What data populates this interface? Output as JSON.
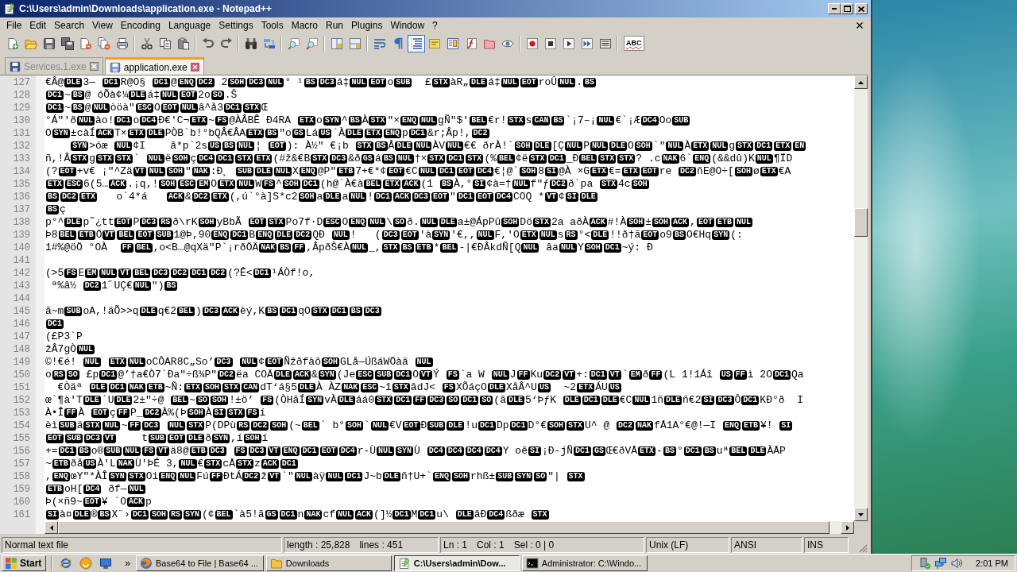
{
  "window": {
    "title": "C:\\Users\\admin\\Downloads\\application.exe - Notepad++"
  },
  "menu": [
    "File",
    "Edit",
    "Search",
    "View",
    "Encoding",
    "Language",
    "Settings",
    "Tools",
    "Macro",
    "Run",
    "Plugins",
    "Window",
    "?"
  ],
  "toolbar": {
    "toggles": [
      {
        "on": false
      },
      {
        "on": false
      },
      {
        "on": true
      }
    ],
    "spell_check": "ABC"
  },
  "tabs": [
    {
      "label": "Services.1.exe",
      "selected": false
    },
    {
      "label": "application.exe",
      "selected": true
    }
  ],
  "editor": {
    "lines": [
      {
        "number": "127",
        "runs": [
          {
            "text": "€Â@",
            "codes": [
              "DLE"
            ]
          },
          {
            "text": "3— ",
            "codes": [
              "DC1"
            ]
          },
          {
            "text": "R@O§ ",
            "codes": [
              "DC1"
            ]
          },
          {
            "text": "@",
            "codes": [
              "ENQ",
              "DC2"
            ]
          },
          {
            "text": " 2",
            "codes": [
              "SOH",
              "DC3",
              "NUL"
            ]
          },
          {
            "text": "° ¹",
            "codes": [
              "BS",
              "DC3"
            ]
          },
          {
            "text": "á‡",
            "codes": [
              "NUL",
              "EOT"
            ]
          },
          {
            "text": "o",
            "codes": [
              "SUB"
            ]
          },
          {
            "text": "  £",
            "codes": [
              "STX"
            ]
          },
          {
            "text": "àR„",
            "codes": [
              "DLE"
            ]
          },
          {
            "text": "á‡",
            "codes": [
              "NUL",
              "EOT"
            ]
          },
          {
            "text": "roÛ",
            "codes": [
              "NUL"
            ]
          },
          {
            "text": ".",
            "codes": [
              "BS"
            ]
          }
        ]
      },
      {
        "number": "128",
        "runs": [
          {
            "codes": [
              "DC1"
            ]
          },
          {
            "text": "~",
            "codes": [
              "BS"
            ]
          },
          {
            "text": "@ óÕà¢¼",
            "codes": [
              "DLE"
            ]
          },
          {
            "text": "á‡",
            "codes": [
              "NUL",
              "EOT"
            ]
          },
          {
            "text": "2o",
            "codes": [
              "SO"
            ]
          },
          {
            "text": ".Š"
          }
        ]
      },
      {
        "number": "129",
        "runs": [
          {
            "codes": [
              "DC1"
            ]
          },
          {
            "text": "~",
            "codes": [
              "BS"
            ]
          },
          {
            "text": "@",
            "codes": [
              "NUL"
            ]
          },
          {
            "text": "òöà\"",
            "codes": [
              "ESC"
            ]
          },
          {
            "text": "O",
            "codes": [
              "EOT",
              "NUL"
            ]
          },
          {
            "text": "â^å3",
            "codes": [
              "DC1",
              "STX"
            ]
          },
          {
            "text": "Œ"
          }
        ]
      },
      {
        "number": "130",
        "runs": [
          {
            "text": "°Á\"'ð",
            "codes": [
              "NUL"
            ]
          },
          {
            "text": "ào!",
            "codes": [
              "DC1"
            ]
          },
          {
            "text": "o",
            "codes": [
              "DC4"
            ]
          },
          {
            "text": "Ð€'C¬",
            "codes": [
              "ETX"
            ]
          },
          {
            "text": "~",
            "codes": [
              "FS"
            ]
          },
          {
            "text": "@ÀÂBÊ Ð4RA ",
            "codes": [
              "ETX"
            ]
          },
          {
            "text": "o",
            "codes": [
              "SYN"
            ]
          },
          {
            "text": "^",
            "codes": [
              "BS"
            ]
          },
          {
            "text": "À",
            "codes": [
              "STX"
            ]
          },
          {
            "text": "\"×",
            "codes": [
              "ENQ",
              "NUL"
            ]
          },
          {
            "text": "gÑ\"$'",
            "codes": [
              "BEL"
            ]
          },
          {
            "text": "€r!",
            "codes": [
              "STX"
            ]
          },
          {
            "text": "s",
            "codes": [
              "CAN",
              "BS"
            ]
          },
          {
            "text": "`¡7–¡",
            "codes": [
              "NUL"
            ]
          },
          {
            "text": "€`¡Æ",
            "codes": [
              "DC4"
            ]
          },
          {
            "text": "Oo",
            "codes": [
              "SUB"
            ]
          }
        ]
      },
      {
        "number": "131",
        "runs": [
          {
            "text": "O",
            "codes": [
              "SYN"
            ]
          },
          {
            "text": "±càÍ",
            "codes": [
              "ACK"
            ]
          },
          {
            "text": "T×",
            "codes": [
              "ETX",
              "DLE"
            ]
          },
          {
            "text": "PÒB`b!°bQÂ"
          },
          {
            "text": "€ÂA",
            "codes": [
              "ETX",
              "BS"
            ]
          },
          {
            "text": "\"o",
            "codes": [
              "GS"
            ]
          },
          {
            "text": "Lá",
            "codes": [
              "US"
            ]
          },
          {
            "text": "`À",
            "codes": [
              "DLE",
              "ETX",
              "ENQ"
            ]
          },
          {
            "text": "p",
            "codes": [
              "DC1"
            ]
          },
          {
            "text": "&r;Âp!,",
            "codes": [
              "DC2"
            ]
          }
        ]
      },
      {
        "number": "132",
        "runs": [
          {
            "indent": true,
            "codes": [
              "SYN"
            ]
          },
          {
            "text": ">óæ ",
            "codes": [
              "NUL"
            ]
          },
          {
            "text": "¢I    â*p`2s",
            "codes": [
              "US",
              "BS",
              "NUL"
            ]
          },
          {
            "text": "¦ ",
            "codes": [
              "EOT"
            ]
          },
          {
            "text": "): À½\" €¡b ",
            "codes": [
              "STX",
              "BS"
            ]
          },
          {
            "text": "Â",
            "codes": [
              "DLE",
              "NUL"
            ]
          },
          {
            "text": "ÀV",
            "codes": [
              "NUL"
            ]
          },
          {
            "text": "€€ ðrÀ!`",
            "codes": [
              "SOH",
              "DLE"
            ]
          },
          {
            "text": "[Ç",
            "codes": [
              "NUL"
            ]
          },
          {
            "text": "P",
            "codes": [
              "NUL",
              "DLE"
            ]
          },
          {
            "text": "O",
            "codes": [
              "SOH"
            ]
          },
          {
            "text": "`\"",
            "codes": [
              "NUL"
            ]
          },
          {
            "text": "À",
            "codes": [
              "ETX",
              "NUL"
            ]
          },
          {
            "text": "g",
            "codes": [
              "STX",
              "DC1",
              "ETX",
              "EN"
            ]
          }
        ]
      },
      {
        "number": "133",
        "runs": [
          {
            "text": "ñ,!Â",
            "codes": [
              "STX"
            ]
          },
          {
            "text": "g",
            "codes": [
              "STX",
              "STX"
            ]
          },
          {
            "text": "` ",
            "codes": [
              "NUL"
            ]
          },
          {
            "text": "ë",
            "codes": [
              "SOH"
            ]
          },
          {
            "text": "ç",
            "codes": [
              "DC4",
              "DC1",
              "STX",
              "ETX"
            ]
          },
          {
            "text": "(#ž&€B",
            "codes": [
              "STX",
              "DC3"
            ]
          },
          {
            "text": "&ð",
            "codes": [
              "GS"
            ]
          },
          {
            "text": "á",
            "codes": [
              "BS",
              "NUL"
            ]
          },
          {
            "text": "†×",
            "codes": [
              "STX",
              "DC1",
              "STX"
            ]
          },
          {
            "text": "(%",
            "codes": [
              "BEL"
            ]
          },
          {
            "text": "¢ë",
            "codes": [
              "STX",
              "DC1"
            ]
          },
          {
            "text": "_Ð",
            "codes": [
              "BEL",
              "STX",
              "STX"
            ]
          },
          {
            "text": "? .c",
            "codes": [
              "NAK"
            ]
          },
          {
            "text": "6`",
            "codes": [
              "ENQ"
            ]
          },
          {
            "text": "(&&dû)K",
            "codes": [
              "NUL"
            ]
          },
          {
            "text": "¶ÏD"
          }
        ]
      },
      {
        "number": "134",
        "runs": [
          {
            "text": "(?",
            "codes": [
              "EOT"
            ]
          },
          {
            "text": "+v€ ¡\"^Zä",
            "codes": [
              "VT",
              "NUL",
              "SOH"
            ]
          },
          {
            "text": "\"",
            "codes": [
              "NAK"
            ]
          },
          {
            "text": ":Ð¸ ",
            "codes": [
              "SUB",
              "DLE",
              "NUL"
            ]
          },
          {
            "text": "X",
            "codes": [
              "ENQ"
            ]
          },
          {
            "text": "@P\"",
            "codes": [
              "ETB"
            ]
          },
          {
            "text": "7+€*¢",
            "codes": [
              "EOT"
            ]
          },
          {
            "text": "€C",
            "codes": [
              "NUL",
              "DC1",
              "EOT",
              "DC4"
            ]
          },
          {
            "text": "€¦@`",
            "codes": [
              "SOH"
            ]
          },
          {
            "text": "8",
            "codes": [
              "SI"
            ]
          },
          {
            "text": "@À ×G",
            "codes": [
              "ETX"
            ]
          },
          {
            "text": "€=",
            "codes": [
              "ETX",
              "EOT"
            ]
          },
          {
            "text": "re ",
            "codes": [
              "DC2"
            ]
          },
          {
            "text": "ñE@O÷[",
            "codes": [
              "SOH"
            ]
          },
          {
            "text": "ø",
            "codes": [
              "ETX"
            ]
          },
          {
            "text": "€A"
          }
        ]
      },
      {
        "number": "135",
        "runs": [
          {
            "codes": [
              "ETX",
              "ESC"
            ]
          },
          {
            "text": "6(5…",
            "codes": [
              "ACK"
            ]
          },
          {
            "text": ".¡q,!",
            "codes": [
              "SOH",
              "ESC",
              "EM"
            ]
          },
          {
            "text": "O",
            "codes": [
              "ETX",
              "NUL"
            ]
          },
          {
            "text": "W",
            "codes": [
              "FS"
            ]
          },
          {
            "text": "^",
            "codes": [
              "SOH",
              "DC1"
            ]
          },
          {
            "text": "(h@`À€à",
            "codes": [
              "BEL",
              "ETX",
              "ACK"
            ]
          },
          {
            "text": "(1 ",
            "codes": [
              "BS"
            ]
          },
          {
            "text": "À,°",
            "codes": [
              "SI"
            ]
          },
          {
            "text": "¢à=†",
            "codes": [
              "NUL"
            ]
          },
          {
            "text": "f\"ƒ",
            "codes": [
              "DC2"
            ]
          },
          {
            "text": "ð`pa ",
            "codes": [
              "STX"
            ]
          },
          {
            "text": "4c",
            "codes": [
              "SOH"
            ]
          }
        ]
      },
      {
        "number": "136",
        "runs": [
          {
            "codes": [
              "BS",
              "DC2",
              "ETX"
            ]
          },
          {
            "text": "   o`4*á   ",
            "codes": [
              "ACK"
            ]
          },
          {
            "text": "&",
            "codes": [
              "DC2",
              "ETX"
            ]
          },
          {
            "text": "(,ú`°à]S*c2",
            "codes": [
              "SOH"
            ]
          },
          {
            "text": "a",
            "codes": [
              "DLE"
            ]
          },
          {
            "text": "a",
            "codes": [
              "NUL"
            ]
          },
          {
            "text": "!",
            "codes": [
              "DC1",
              "ACK",
              "DC3",
              "EOT"
            ]
          },
          {
            "text": "\"",
            "codes": [
              "DC1",
              "EOT",
              "DC4"
            ]
          },
          {
            "text": "COQ *",
            "codes": [
              "VT"
            ]
          },
          {
            "text": "¢",
            "codes": [
              "SI",
              "DLE"
            ]
          }
        ]
      },
      {
        "number": "137",
        "runs": [
          {
            "codes": [
              "BS"
            ]
          },
          {
            "text": "ç"
          }
        ]
      },
      {
        "number": "138",
        "runs": [
          {
            "text": "p°^",
            "codes": [
              "DLE"
            ]
          },
          {
            "text": "p˜¿tt",
            "codes": [
              "EOT"
            ]
          },
          {
            "text": "P",
            "codes": [
              "DC3",
              "RS"
            ]
          },
          {
            "text": "ð\\rK",
            "codes": [
              "SOH"
            ]
          },
          {
            "text": "yBbÃ ",
            "codes": [
              "EOT",
              "STX"
            ]
          },
          {
            "text": "Po7f·D",
            "codes": [
              "ESC"
            ]
          },
          {
            "text": "O",
            "codes": [
              "ENQ",
              "NUL"
            ]
          },
          {
            "text": "\\",
            "codes": [
              "SO"
            ]
          },
          {
            "text": "ð.",
            "codes": [
              "NUL",
              "DLE"
            ]
          },
          {
            "text": "a±@ÁpPû",
            "codes": [
              "SOH"
            ]
          },
          {
            "text": "Dö",
            "codes": [
              "STX"
            ]
          },
          {
            "text": "2a aðÀ",
            "codes": [
              "ACK"
            ]
          },
          {
            "text": "#!À",
            "codes": [
              "SOH"
            ]
          },
          {
            "text": "±",
            "codes": [
              "SOH",
              "ACK"
            ]
          },
          {
            "text": ",",
            "codes": [
              "EOT",
              "ETB",
              "NUL"
            ]
          }
        ]
      },
      {
        "number": "139",
        "runs": [
          {
            "text": "Þ8",
            "codes": [
              "BEL",
              "ETB"
            ]
          },
          {
            "text": "Ö",
            "codes": [
              "VT",
              "BEL",
              "EOT",
              "SUB"
            ]
          },
          {
            "text": "1@Þ,90",
            "codes": [
              "ENQ",
              "DC1"
            ]
          },
          {
            "text": "B",
            "codes": [
              "ENQ",
              "DLE",
              "DC2"
            ]
          },
          {
            "text": "QÐ ",
            "codes": [
              "NUL"
            ]
          },
          {
            "text": "!   (",
            "codes": [
              "DC3",
              "EOT"
            ]
          },
          {
            "text": "'à",
            "codes": [
              "SYN"
            ]
          },
          {
            "text": "'€,,",
            "codes": [
              "NUL"
            ]
          },
          {
            "text": "F,'O",
            "codes": [
              "ETX",
              "NUL"
            ]
          },
          {
            "text": "s",
            "codes": [
              "RS"
            ]
          },
          {
            "text": "°<",
            "codes": [
              "DLE"
            ]
          },
          {
            "text": "!!ð†ã",
            "codes": [
              "EOT"
            ]
          },
          {
            "text": "o9",
            "codes": [
              "BS"
            ]
          },
          {
            "text": "O€Hq",
            "codes": [
              "SYN"
            ]
          },
          {
            "text": "(:"
          }
        ]
      },
      {
        "number": "140",
        "runs": [
          {
            "text": "1#%@öÖ °OÀ  ",
            "codes": [
              "FF",
              "BEL"
            ]
          },
          {
            "text": ",o<B…@qXä\"P`¡rðÖÄ",
            "codes": [
              "NAK",
              "BS",
              "FF"
            ]
          },
          {
            "text": ",ÂpðŠ€À",
            "codes": [
              "NUL"
            ]
          },
          {
            "text": "_,",
            "codes": [
              "STX",
              "BS",
              "ETB"
            ]
          },
          {
            "text": "*",
            "codes": [
              "BEL"
            ]
          },
          {
            "text": "-|€ÐÂkdÑ[Q",
            "codes": [
              "NUL"
            ]
          },
          {
            "text": " âa",
            "codes": [
              "NUL"
            ]
          },
          {
            "text": "Y",
            "codes": [
              "SOH",
              "DC1"
            ]
          },
          {
            "text": "~ý: Ð"
          }
        ]
      },
      {
        "number": "141"
      },
      {
        "number": "142",
        "runs": [
          {
            "text": "(>5",
            "codes": [
              "FS"
            ]
          },
          {
            "text": "E",
            "codes": [
              "EM",
              "NUL",
              "VT",
              "BEL",
              "DC3",
              "DC2",
              "DC1",
              "DC2"
            ]
          },
          {
            "text": "(?Ê<",
            "codes": [
              "DC1"
            ]
          },
          {
            "text": "¹ÁÒf!o,"
          }
        ]
      },
      {
        "number": "143",
        "runs": [
          {
            "text": " ª%â½ ",
            "codes": [
              "DC2"
            ]
          },
          {
            "text": "1˝UÇ€",
            "codes": [
              "NUL"
            ]
          },
          {
            "text": "\")",
            "codes": [
              "BS"
            ]
          }
        ]
      },
      {
        "number": "144"
      },
      {
        "number": "145",
        "runs": [
          {
            "text": "ã~m",
            "codes": [
              "SUB"
            ]
          },
          {
            "text": "oA,!äÕ>>q",
            "codes": [
              "DLE"
            ]
          },
          {
            "text": "q€2",
            "codes": [
              "BEL"
            ]
          },
          {
            "text": ")",
            "codes": [
              "DC3",
              "ACK"
            ]
          },
          {
            "text": "èý,K",
            "codes": [
              "BS",
              "DC1"
            ]
          },
          {
            "text": "qO",
            "codes": [
              "STX",
              "DC1",
              "BS",
              "DC3"
            ]
          }
        ]
      },
      {
        "number": "146",
        "runs": [
          {
            "codes": [
              "DC1"
            ]
          }
        ]
      },
      {
        "number": "147",
        "runs": [
          {
            "text": "(£P3`P"
          }
        ]
      },
      {
        "number": "148",
        "runs": [
          {
            "text": "žÂ7gÒ",
            "codes": [
              "NUL"
            ]
          }
        ]
      },
      {
        "number": "149",
        "runs": [
          {
            "text": "©!€é! ",
            "codes": [
              "NUL"
            ]
          },
          {
            "space_before": true,
            "codes": [
              "ETX",
              "NUL"
            ]
          },
          {
            "text": "oCÔAR8C„So’",
            "codes": [
              "DC3"
            ]
          },
          {
            "space_before": true,
            "codes": [
              "NUL"
            ]
          },
          {
            "text": "¢",
            "codes": [
              "EOT"
            ]
          },
          {
            "text": "Ñžðfàô",
            "codes": [
              "SOH"
            ]
          },
          {
            "text": "GLå—ÚßáWÖàä ",
            "codes": [
              "NUL"
            ]
          }
        ]
      },
      {
        "number": "150",
        "runs": [
          {
            "text": "o",
            "codes": [
              "RS",
              "SO"
            ]
          },
          {
            "text": " £p",
            "codes": [
              "DC1"
            ]
          },
          {
            "text": "@’†a€Ò7`Ða\"÷ß¾P\"",
            "codes": [
              "DC2"
            ]
          },
          {
            "text": "ëa COÄ",
            "codes": [
              "DLE",
              "ACK"
            ]
          },
          {
            "text": "&",
            "codes": [
              "SYN"
            ]
          },
          {
            "text": "(Je",
            "codes": [
              "ESC",
              "SUB",
              "DC1"
            ]
          },
          {
            "text": "O",
            "codes": [
              "VT"
            ]
          },
          {
            "text": "Ý ",
            "codes": [
              "FS"
            ]
          },
          {
            "text": "`a W ",
            "codes": [
              "NUL"
            ]
          },
          {
            "text": "J",
            "codes": [
              "FF"
            ]
          },
          {
            "text": "Ku",
            "codes": [
              "DC2",
              "VT"
            ]
          },
          {
            "text": "+:",
            "codes": [
              "DC1",
              "VT"
            ]
          },
          {
            "text": "`",
            "codes": [
              "EM"
            ]
          },
          {
            "text": "ð",
            "codes": [
              "FF"
            ]
          },
          {
            "text": "(L 1!1Áî ",
            "codes": [
              "US",
              "FF"
            ]
          },
          {
            "text": "ì 2O",
            "codes": [
              "DC1"
            ]
          },
          {
            "text": "Qa"
          }
        ]
      },
      {
        "number": "151",
        "runs": [
          {
            "text": "  €Òäª ",
            "codes": [
              "DLE",
              "DC1",
              "NAK",
              "ETB"
            ]
          },
          {
            "text": "~Ñ:",
            "codes": [
              "ETX",
              "SOH",
              "STX",
              "CAN"
            ]
          },
          {
            "text": "dT‘á§5",
            "codes": [
              "DLE"
            ]
          },
          {
            "text": "À ÀZ",
            "codes": [
              "NAK",
              "ESC"
            ]
          },
          {
            "text": "~î",
            "codes": [
              "STX"
            ]
          },
          {
            "text": "âdJ< ",
            "codes": [
              "FS"
            ]
          },
          {
            "text": "XÕáçO",
            "codes": [
              "DLE"
            ]
          },
          {
            "text": "XåÂ^U",
            "codes": [
              "US"
            ]
          },
          {
            "text": "  ~2",
            "codes": [
              "ETX"
            ]
          },
          {
            "text": "ÁU",
            "codes": [
              "US"
            ]
          }
        ]
      },
      {
        "number": "152",
        "runs": [
          {
            "text": "œ`¶à'T",
            "codes": [
              "DLE"
            ]
          },
          {
            "text": "`U",
            "codes": [
              "DLE"
            ]
          },
          {
            "text": "2±\"÷@ ",
            "codes": [
              "BEL"
            ]
          },
          {
            "text": "~",
            "codes": [
              "SO",
              "SOH"
            ]
          },
          {
            "text": "!±ö’ ",
            "codes": [
              "FS"
            ]
          },
          {
            "text": "(ÒHãÍ",
            "codes": [
              "SYN"
            ]
          },
          {
            "text": "vÀ",
            "codes": [
              "DLE"
            ]
          },
          {
            "text": "áá0",
            "codes": [
              "STX",
              "DC1",
              "FF",
              "DC3",
              "SO",
              "DC1",
              "SO"
            ]
          },
          {
            "text": "(ã",
            "codes": [
              "DLE"
            ]
          },
          {
            "text": "5‘ÞƒK ",
            "codes": [
              "DLE",
              "DC1",
              "DLE"
            ]
          },
          {
            "text": "€C",
            "codes": [
              "NUL"
            ]
          },
          {
            "text": "1ñ",
            "codes": [
              "DLE"
            ]
          },
          {
            "text": "ñ€2",
            "codes": [
              "SI",
              "DC3"
            ]
          },
          {
            "text": "Ô",
            "codes": [
              "DC1"
            ]
          },
          {
            "text": "KÐ°ð  I"
          }
        ]
      },
      {
        "number": "153",
        "runs": [
          {
            "text": "À•Î",
            "codes": [
              "FF"
            ]
          },
          {
            "text": "À ",
            "codes": [
              "EOT"
            ]
          },
          {
            "text": "ç",
            "codes": [
              "FF"
            ]
          },
          {
            "text": "P_",
            "codes": [
              "DC2"
            ]
          },
          {
            "text": "À%(Þ",
            "codes": [
              "SOH"
            ]
          },
          {
            "text": "À",
            "codes": [
              "SI",
              "STX",
              "FS"
            ]
          },
          {
            "text": "í"
          }
        ]
      },
      {
        "number": "154",
        "runs": [
          {
            "text": "èì",
            "codes": [
              "SUB"
            ]
          },
          {
            "text": "ä",
            "codes": [
              "STX",
              "NUL"
            ]
          },
          {
            "text": "~",
            "codes": [
              "FF",
              "DC3"
            ]
          },
          {
            "space_before": true,
            "codes": [
              "NUL",
              "STX"
            ]
          },
          {
            "text": "P(DPù",
            "codes": [
              "RS",
              "DC2",
              "SOH"
            ]
          },
          {
            "text": "(~",
            "codes": [
              "BEL"
            ]
          },
          {
            "text": "` b°",
            "codes": [
              "SOH"
            ]
          },
          {
            "text": "`",
            "codes": [
              "NUL"
            ]
          },
          {
            "text": "€V",
            "codes": [
              "EOT"
            ]
          },
          {
            "text": "Ð",
            "codes": [
              "SUB",
              "DLE"
            ]
          },
          {
            "text": "!u",
            "codes": [
              "DC1"
            ]
          },
          {
            "text": "Dp",
            "codes": [
              "DC1"
            ]
          },
          {
            "text": "D°€",
            "codes": [
              "SOH",
              "STX"
            ]
          },
          {
            "text": "U^ @ ",
            "codes": [
              "DC2",
              "NAK"
            ]
          },
          {
            "text": "fÅ1A°€@!—I ",
            "codes": [
              "ENQ",
              "ETB"
            ]
          },
          {
            "text": "¥! ",
            "codes": [
              "SI"
            ]
          }
        ]
      },
      {
        "number": "155",
        "runs": [
          {
            "codes": [
              "EOT",
              "SUB",
              "DC3",
              "VT"
            ]
          },
          {
            "text": "    t",
            "codes": [
              "SUB",
              "EOT",
              "DLE"
            ]
          },
          {
            "text": "ð",
            "codes": [
              "SYN"
            ]
          },
          {
            "text": ",í",
            "codes": [
              "SOH"
            ]
          },
          {
            "text": "í"
          }
        ]
      },
      {
        "number": "156",
        "runs": [
          {
            "text": "+=",
            "codes": [
              "DC1",
              "BS"
            ]
          },
          {
            "text": "o®",
            "codes": [
              "SUB",
              "NUL",
              "FS",
              "VT"
            ]
          },
          {
            "text": "ä8@",
            "codes": [
              "ETB",
              "DC3"
            ]
          },
          {
            "space_before": true,
            "codes": [
              "FS",
              "DC3",
              "VT",
              "ENQ",
              "DC1",
              "EOT",
              "DC4"
            ]
          },
          {
            "text": "r-Ù",
            "codes": [
              "NUL",
              "SYN"
            ]
          },
          {
            "text": "Ù ",
            "codes": [
              "DC4",
              "DC4",
              "DC4",
              "DC4"
            ]
          },
          {
            "text": "Y oê",
            "codes": [
              "SI"
            ]
          },
          {
            "text": "¡Ð-jÑ",
            "codes": [
              "DC1",
              "GS"
            ]
          },
          {
            "text": "Œ€ðVÅ",
            "codes": [
              "ETX"
            ]
          },
          {
            "text": "-",
            "codes": [
              "BS"
            ]
          },
          {
            "text": "°",
            "codes": [
              "DC1",
              "BS"
            ]
          },
          {
            "text": "uª",
            "codes": [
              "BEL",
              "DLE"
            ]
          },
          {
            "text": "ÀÅP"
          }
        ]
      },
      {
        "number": "157",
        "runs": [
          {
            "text": "~",
            "codes": [
              "ETB"
            ]
          },
          {
            "text": "ðå",
            "codes": [
              "US"
            ]
          },
          {
            "text": "À'L",
            "codes": [
              "NAK"
            ]
          },
          {
            "text": "Ù'ÞÉ 3,",
            "codes": [
              "NUL"
            ]
          },
          {
            "text": "€",
            "codes": [
              "STX"
            ]
          },
          {
            "text": "cÅ",
            "codes": [
              "STX"
            ]
          },
          {
            "text": "z",
            "codes": [
              "ACK",
              "DC1"
            ]
          }
        ]
      },
      {
        "number": "158",
        "runs": [
          {
            "text": ",",
            "codes": [
              "ENQ"
            ]
          },
          {
            "text": "œY\"*ÀÎ",
            "codes": [
              "SYN",
              "STX"
            ]
          },
          {
            "text": "Oi",
            "codes": [
              "ENQ",
              "NUL"
            ]
          },
          {
            "text": "Fú",
            "codes": [
              "FF"
            ]
          },
          {
            "text": "ÐtÁ",
            "codes": [
              "DC2"
            ]
          },
          {
            "text": "ž",
            "codes": [
              "VT"
            ]
          },
          {
            "text": "`\"",
            "codes": [
              "NUL"
            ]
          },
          {
            "text": "àÿ",
            "codes": [
              "NUL",
              "DC1"
            ]
          },
          {
            "text": "J~b",
            "codes": [
              "DLE"
            ]
          },
          {
            "text": "ñ†U+`",
            "codes": [
              "ENQ",
              "SOH"
            ]
          },
          {
            "text": "rhß±",
            "codes": [
              "SUB",
              "SYN",
              "SO"
            ]
          },
          {
            "text": "\"| ",
            "codes": [
              "STX"
            ]
          }
        ]
      },
      {
        "number": "159",
        "runs": [
          {
            "codes": [
              "ETB"
            ]
          },
          {
            "text": "oH[",
            "codes": [
              "DC4"
            ]
          },
          {
            "text": " ðf—",
            "codes": [
              "NUL"
            ]
          }
        ]
      },
      {
        "number": "160",
        "runs": [
          {
            "text": "Þ(×ñ9~",
            "codes": [
              "EOT"
            ]
          },
          {
            "text": "¥ ´O",
            "codes": [
              "ACK"
            ]
          },
          {
            "text": "p"
          }
        ]
      },
      {
        "number": "161",
        "runs": [
          {
            "codes": [
              "SI"
            ]
          },
          {
            "text": "à¤",
            "codes": [
              "DLE"
            ]
          },
          {
            "text": "®",
            "codes": [
              "BS"
            ]
          },
          {
            "text": "X¨›",
            "codes": [
              "DC1",
              "SOH",
              "RS",
              "SYN"
            ]
          },
          {
            "text": "(¢",
            "codes": [
              "BEL"
            ]
          },
          {
            "text": "`à5!ã",
            "codes": [
              "GS",
              "DC1"
            ]
          },
          {
            "text": "n",
            "codes": [
              "NAK"
            ]
          },
          {
            "text": "cf",
            "codes": [
              "NUL",
              "ACK"
            ]
          },
          {
            "text": "(]½",
            "codes": [
              "DC1"
            ]
          },
          {
            "text": "M",
            "codes": [
              "DC1"
            ]
          },
          {
            "text": "u\\ ",
            "codes": [
              "DLE"
            ]
          },
          {
            "text": "âÐ",
            "codes": [
              "DC4"
            ]
          },
          {
            "text": "ßðæ ",
            "codes": [
              "STX"
            ]
          }
        ]
      }
    ]
  },
  "status_bar": {
    "file_type": "Normal text file",
    "length": "length : 25,828",
    "lines": "lines : 451",
    "line": "Ln : 1",
    "column": "Col : 1",
    "selection": "Sel : 0 | 0",
    "eol": "Unix (LF)",
    "encoding": "ANSI",
    "mode": "INS"
  },
  "taskbar": {
    "start": "Start",
    "more": "»",
    "tasks": [
      {
        "label": "Base64 to File | Base64 ...",
        "selected": false
      },
      {
        "label": "Downloads",
        "selected": false
      },
      {
        "label": "C:\\Users\\admin\\Dow...",
        "selected": true
      },
      {
        "label": "Administrator: C:\\Windo...",
        "selected": false
      }
    ],
    "clock": "2:01 PM"
  }
}
